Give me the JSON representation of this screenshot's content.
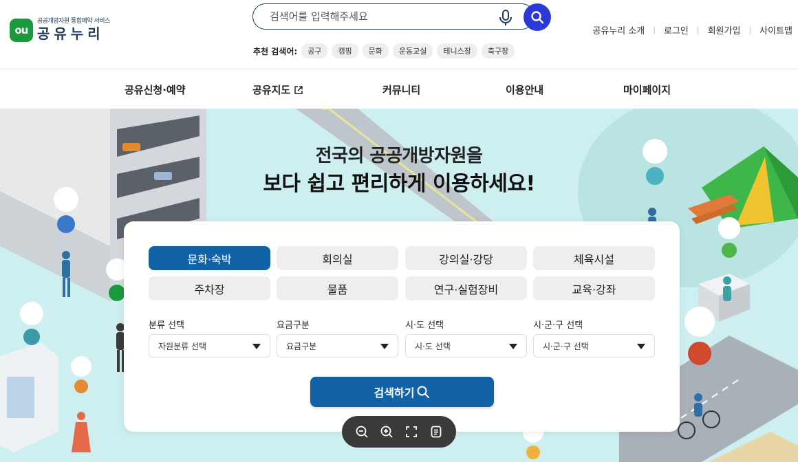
{
  "header": {
    "logo": {
      "mark": "ou",
      "sub": "공공개방자원 통합예약 서비스",
      "name": "공유누리"
    },
    "search": {
      "placeholder": "검색어를 입력해주세요"
    },
    "recommended": {
      "label": "추천 검색어:",
      "tags": [
        "공구",
        "캠핑",
        "문화",
        "운동교실",
        "테니스장",
        "축구장"
      ]
    },
    "util_links": [
      "공유누리 소개",
      "로그인",
      "회원가입",
      "사이트맵"
    ]
  },
  "nav": {
    "items": [
      "공유신청·예약",
      "공유지도",
      "커뮤니티",
      "이용안내",
      "마이페이지"
    ]
  },
  "hero": {
    "headline_line1": "전국의 공공개방자원을",
    "headline_line2": "보다 쉽고 편리하게 이용하세요!"
  },
  "search_panel": {
    "categories": [
      "문화·숙박",
      "회의실",
      "강의실·강당",
      "체육시설",
      "주차장",
      "물품",
      "연구·실험장비",
      "교육·강좌"
    ],
    "active_category": "문화·숙박",
    "filters": [
      {
        "label": "분류 선택",
        "value": "자원분류 선택"
      },
      {
        "label": "요금구분",
        "value": "요금구분"
      },
      {
        "label": "시·도 선택",
        "value": "시·도 선택"
      },
      {
        "label": "시·군·구 선택",
        "value": "시·군·구 선택"
      }
    ],
    "submit_label": "검색하기"
  },
  "zoom_toolbar": {
    "icons": [
      "zoom-out-icon",
      "zoom-in-icon",
      "fullscreen-icon",
      "document-icon"
    ]
  },
  "colors": {
    "brand_green": "#1a9a3c",
    "primary_blue": "#1262a8",
    "search_button": "#2b3ad6",
    "hero_background": "#cdeff0"
  }
}
